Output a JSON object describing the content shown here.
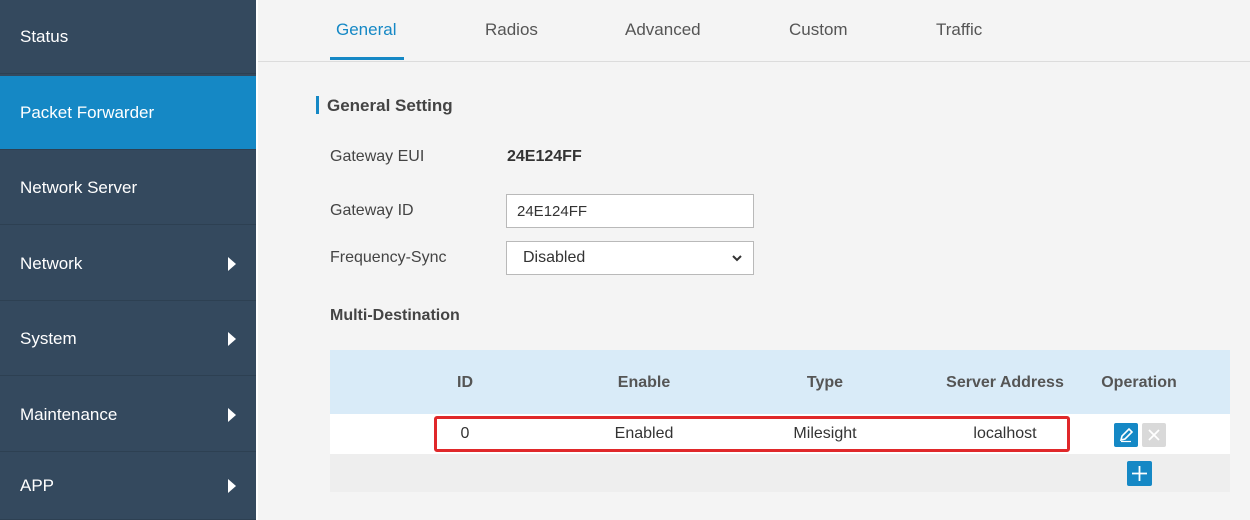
{
  "sidebar": {
    "items": [
      {
        "label": "Status"
      },
      {
        "label": "Packet Forwarder"
      },
      {
        "label": "Network Server"
      },
      {
        "label": "Network"
      },
      {
        "label": "System"
      },
      {
        "label": "Maintenance"
      },
      {
        "label": "APP"
      }
    ]
  },
  "tabs": [
    {
      "label": "General"
    },
    {
      "label": "Radios"
    },
    {
      "label": "Advanced"
    },
    {
      "label": "Custom"
    },
    {
      "label": "Traffic"
    }
  ],
  "section": {
    "title": "General Setting"
  },
  "fields": {
    "gateway_eui_label": "Gateway EUI",
    "gateway_eui_value": "24E124FF",
    "gateway_id_label": "Gateway ID",
    "gateway_id_value": "24E124FF",
    "frequency_sync_label": "Frequency-Sync",
    "frequency_sync_value": "Disabled"
  },
  "multi_destination": {
    "title": "Multi-Destination",
    "columns": [
      "ID",
      "Enable",
      "Type",
      "Server Address",
      "Operation"
    ],
    "rows": [
      {
        "id": "0",
        "enable": "Enabled",
        "type": "Milesight",
        "server_address": "localhost"
      }
    ]
  },
  "icons": {
    "edit": "pencil-icon",
    "delete": "close-icon",
    "add": "plus-icon",
    "expand": "caret-right-icon",
    "dropdown": "chevron-down-icon"
  },
  "colors": {
    "sidebar_bg": "#34495e",
    "accent": "#1588c5",
    "highlight": "#e0282a",
    "table_header": "#d9ebf8"
  }
}
